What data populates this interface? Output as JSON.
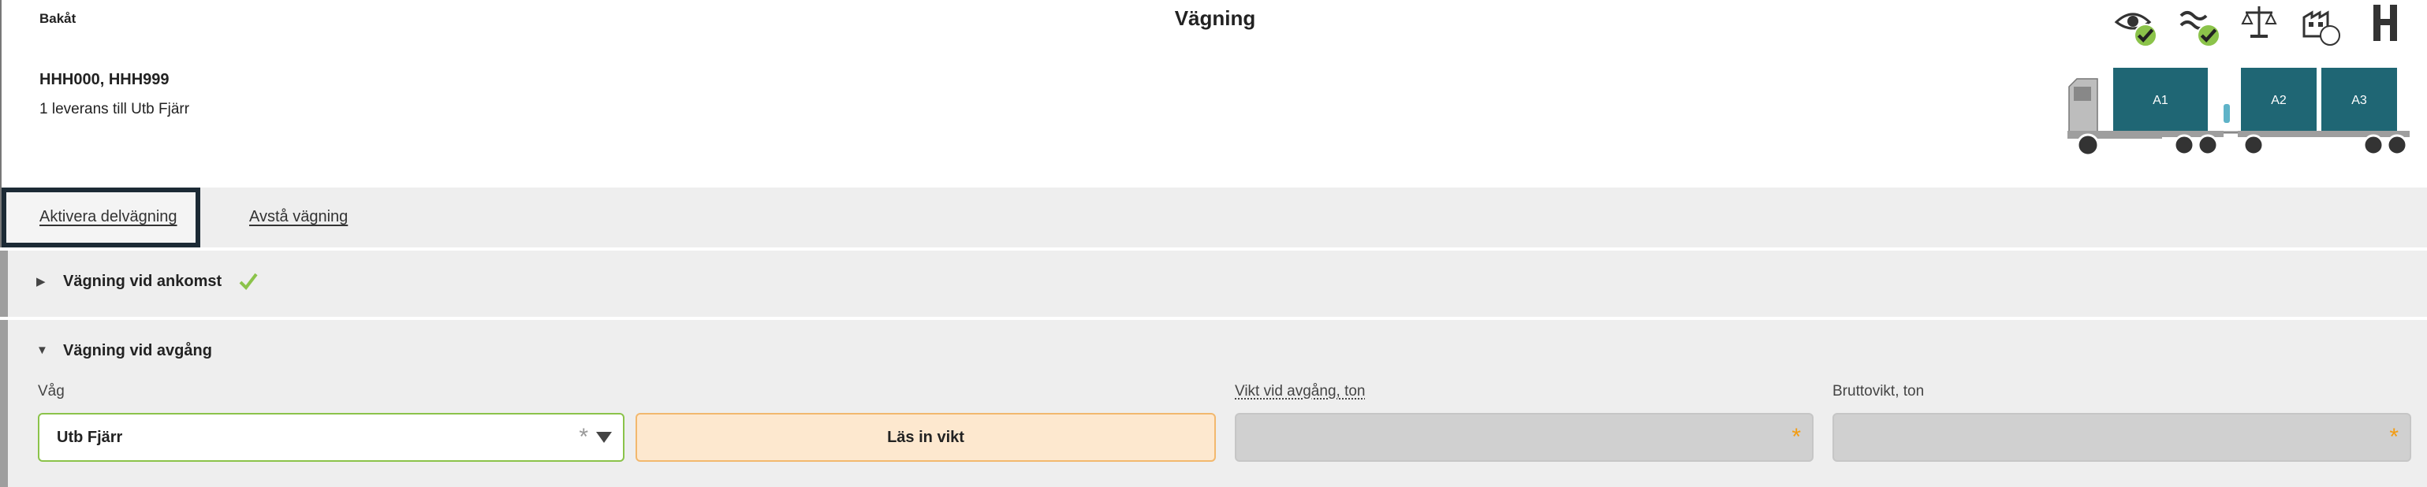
{
  "header": {
    "back_label": "Bakåt",
    "title": "Vägning",
    "registration": "HHH000, HHH999",
    "delivery_info": "1 leverans till Utb Fjärr"
  },
  "vehicle": {
    "units": [
      "A1",
      "A2",
      "A3"
    ],
    "box_color": "#1f6674"
  },
  "tabs": {
    "activate": "Aktivera delvägning",
    "skip": "Avstå vägning"
  },
  "sections": {
    "arrival_title": "Vägning vid ankomst",
    "departure_title": "Vägning vid avgång"
  },
  "form": {
    "scale_label": "Våg",
    "scale_value": "Utb Fjärr",
    "read_weight_button": "Läs in vikt",
    "departure_weight_label": "Vikt vid avgång, ton",
    "gross_weight_label": "Bruttovikt, ton",
    "required_marker": "*"
  },
  "colors": {
    "accent_green": "#8bc34a",
    "required_orange": "#f39c12",
    "button_bg": "#fde8cf",
    "active_tab_border": "#1c2a35"
  }
}
